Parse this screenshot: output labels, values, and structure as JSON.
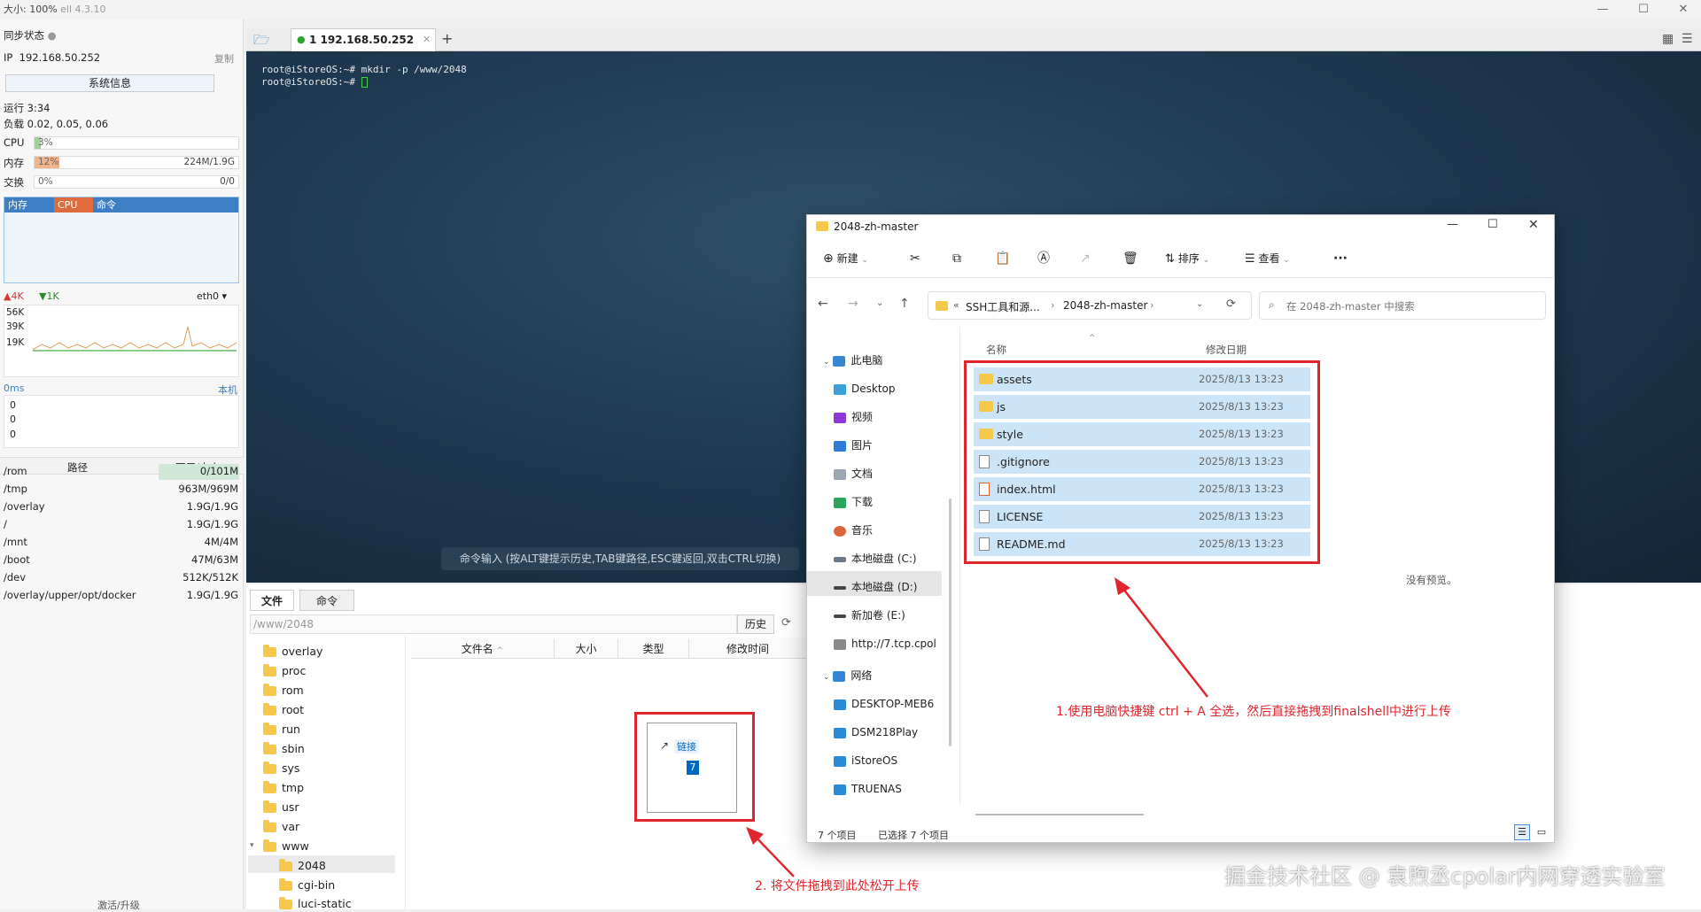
{
  "app": {
    "title_prefix": "大小: 100%",
    "title_suffix": "ell 4.3.10"
  },
  "left_panel": {
    "sync_status": "同步状态",
    "ip_label": "IP",
    "ip": "192.168.50.252",
    "copy": "复制",
    "sysinfo_button": "系统信息",
    "uptime": "运行 3:34",
    "load": "负载 0.02, 0.05, 0.06",
    "cpu_label": "CPU",
    "cpu_value": "3%",
    "cpu_fraction": 0.03,
    "mem_label": "内存",
    "mem_value": "12%",
    "mem_fraction": 0.12,
    "mem_right": "224M/1.9G",
    "swap_label": "交换",
    "swap_value": "0%",
    "swap_right": "0/0",
    "tab_mem": "内存",
    "tab_cpu": "CPU",
    "tab_cmd": "命令",
    "net_up": "4K",
    "net_down": "1K",
    "net_iface": "eth0",
    "net_scale": [
      "56K",
      "39K",
      "19K"
    ],
    "ping": "0ms",
    "ping_host": "本机",
    "ping_vals": [
      "0",
      "0",
      "0"
    ],
    "fs_header_path": "路径",
    "fs_header_size": "可用/大小",
    "fs_rows": [
      {
        "path": "/rom",
        "size": "0/101M"
      },
      {
        "path": "/tmp",
        "size": "963M/969M"
      },
      {
        "path": "/overlay",
        "size": "1.9G/1.9G"
      },
      {
        "path": "/",
        "size": "1.9G/1.9G"
      },
      {
        "path": "/mnt",
        "size": "4M/4M"
      },
      {
        "path": "/boot",
        "size": "47M/63M"
      },
      {
        "path": "/dev",
        "size": "512K/512K"
      },
      {
        "path": "/overlay/upper/opt/docker",
        "size": "1.9G/1.9G"
      }
    ],
    "activate": "激活/升级"
  },
  "terminal": {
    "tab_label": "1 192.168.50.252",
    "line1": "root@iStoreOS:~# mkdir -p /www/2048",
    "line2": "root@iStoreOS:~# ",
    "cmd_hint": "命令输入 (按ALT键提示历史,TAB键路径,ESC键返回,双击CTRL切换)"
  },
  "file_panel": {
    "tab_files": "文件",
    "tab_cmd": "命令",
    "path": "/www/2048",
    "history": "历史",
    "tree": [
      "overlay",
      "proc",
      "rom",
      "root",
      "run",
      "sbin",
      "sys",
      "tmp",
      "usr",
      "var",
      "www",
      "2048",
      "cgi-bin",
      "luci-static"
    ],
    "col_name": "文件名",
    "col_size": "大小",
    "col_type": "类型",
    "col_mtime": "修改时间",
    "drag_badge": "链接",
    "drag_count": "7"
  },
  "explorer": {
    "title": "2048-zh-master",
    "new": "新建",
    "sort": "排序",
    "view": "查看",
    "breadcrumb1": "SSH工具和源...",
    "breadcrumb2": "2048-zh-master",
    "search_placeholder": "在 2048-zh-master 中搜索",
    "nav": [
      "此电脑",
      "Desktop",
      "视频",
      "图片",
      "文档",
      "下载",
      "音乐",
      "本地磁盘 (C:)",
      "本地磁盘 (D:)",
      "新加卷 (E:)",
      "http://7.tcp.cpol",
      "网络",
      "DESKTOP-MEB6",
      "DSM218Play",
      "iStoreOS",
      "TRUENAS"
    ],
    "col_name": "名称",
    "col_date": "修改日期",
    "files": [
      {
        "name": "assets",
        "date": "2025/8/13 13:23",
        "kind": "folder"
      },
      {
        "name": "js",
        "date": "2025/8/13 13:23",
        "kind": "folder"
      },
      {
        "name": "style",
        "date": "2025/8/13 13:23",
        "kind": "folder"
      },
      {
        "name": ".gitignore",
        "date": "2025/8/13 13:23",
        "kind": "file"
      },
      {
        "name": "index.html",
        "date": "2025/8/13 13:23",
        "kind": "file"
      },
      {
        "name": "LICENSE",
        "date": "2025/8/13 13:23",
        "kind": "file"
      },
      {
        "name": "README.md",
        "date": "2025/8/13 13:23",
        "kind": "file"
      }
    ],
    "no_preview": "没有预览。",
    "status_count": "7 个项目",
    "status_selected": "已选择 7 个项目"
  },
  "annotations": {
    "note1": "1.使用电脑快捷键 ctrl + A 全选，然后直接拖拽到finalshell中进行上传",
    "note2": "2. 将文件拖拽到此处松开上传"
  },
  "watermark": "掘金技术社区 @ 袁煦丞cpolar内网穿透实验室",
  "colors": {
    "accent": "#0067c0",
    "red": "#e0262d",
    "select": "#cce4f7"
  }
}
